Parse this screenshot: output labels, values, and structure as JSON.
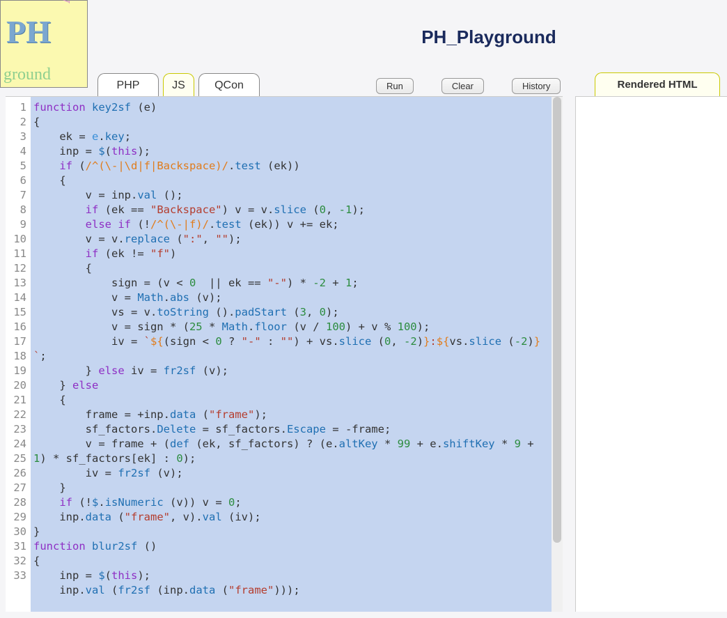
{
  "app_title": "PH_Playground",
  "logo": {
    "ph": "PH",
    "play": "play",
    "ground": "ground"
  },
  "tabs": [
    {
      "label": "PHP",
      "active": false
    },
    {
      "label": "JS",
      "active": true
    },
    {
      "label": "QCon",
      "active": false
    }
  ],
  "actions": {
    "run": "Run",
    "clear": "Clear",
    "history": "History"
  },
  "right_tab": "Rendered HTML",
  "editor": {
    "lines": [
      {
        "n": 1,
        "seg": [
          [
            "kw",
            "function "
          ],
          [
            "fn",
            "key2sf"
          ],
          [
            "op",
            " (e)"
          ]
        ]
      },
      {
        "n": 2,
        "seg": [
          [
            "op",
            "{"
          ]
        ]
      },
      {
        "n": 3,
        "seg": [
          [
            "op",
            "    ek = "
          ],
          [
            "var",
            "e"
          ],
          [
            "op",
            "."
          ],
          [
            "fn",
            "key"
          ],
          [
            "op",
            ";"
          ]
        ]
      },
      {
        "n": 4,
        "seg": [
          [
            "op",
            "    inp = "
          ],
          [
            "fn",
            "$"
          ],
          [
            "op",
            "("
          ],
          [
            "kw",
            "this"
          ],
          [
            "op",
            ");"
          ]
        ]
      },
      {
        "n": 5,
        "seg": [
          [
            "op",
            "    "
          ],
          [
            "kw",
            "if"
          ],
          [
            "op",
            " ("
          ],
          [
            "rgx",
            "/^(\\-|\\d|f|Backspace)/"
          ],
          [
            "op",
            "."
          ],
          [
            "fn",
            "test"
          ],
          [
            "op",
            " (ek))"
          ]
        ]
      },
      {
        "n": 6,
        "seg": [
          [
            "op",
            "    {"
          ]
        ]
      },
      {
        "n": 7,
        "seg": [
          [
            "op",
            "        v = inp."
          ],
          [
            "fn",
            "val"
          ],
          [
            "op",
            " ();"
          ]
        ]
      },
      {
        "n": 8,
        "seg": [
          [
            "op",
            "        "
          ],
          [
            "kw",
            "if"
          ],
          [
            "op",
            " (ek == "
          ],
          [
            "str",
            "\"Backspace\""
          ],
          [
            "op",
            ") v = v."
          ],
          [
            "fn",
            "slice"
          ],
          [
            "op",
            " ("
          ],
          [
            "num",
            "0"
          ],
          [
            "op",
            ", "
          ],
          [
            "num",
            "-1"
          ],
          [
            "op",
            ");"
          ]
        ]
      },
      {
        "n": 9,
        "seg": [
          [
            "op",
            "        "
          ],
          [
            "kw",
            "else if"
          ],
          [
            "op",
            " (!"
          ],
          [
            "rgx",
            "/^(\\-|f)/"
          ],
          [
            "op",
            "."
          ],
          [
            "fn",
            "test"
          ],
          [
            "op",
            " (ek)) v += ek;"
          ]
        ]
      },
      {
        "n": 10,
        "seg": [
          [
            "op",
            "        v = v."
          ],
          [
            "fn",
            "replace"
          ],
          [
            "op",
            " ("
          ],
          [
            "str",
            "\":\""
          ],
          [
            "op",
            ", "
          ],
          [
            "str",
            "\"\""
          ],
          [
            "op",
            ");"
          ]
        ]
      },
      {
        "n": 11,
        "seg": [
          [
            "op",
            "        "
          ],
          [
            "kw",
            "if"
          ],
          [
            "op",
            " (ek != "
          ],
          [
            "str",
            "\"f\""
          ],
          [
            "op",
            ")"
          ]
        ]
      },
      {
        "n": 12,
        "seg": [
          [
            "op",
            "        {"
          ]
        ]
      },
      {
        "n": 13,
        "seg": [
          [
            "op",
            "            sign = (v < "
          ],
          [
            "num",
            "0"
          ],
          [
            "op",
            "  || ek == "
          ],
          [
            "str",
            "\"-\""
          ],
          [
            "op",
            ") * "
          ],
          [
            "num",
            "-2"
          ],
          [
            "op",
            " + "
          ],
          [
            "num",
            "1"
          ],
          [
            "op",
            ";"
          ]
        ]
      },
      {
        "n": 14,
        "seg": [
          [
            "op",
            "            v = "
          ],
          [
            "fn",
            "Math"
          ],
          [
            "op",
            "."
          ],
          [
            "fn",
            "abs"
          ],
          [
            "op",
            " (v);"
          ]
        ]
      },
      {
        "n": 15,
        "seg": [
          [
            "op",
            "            vs = v."
          ],
          [
            "fn",
            "toString"
          ],
          [
            "op",
            " ()."
          ],
          [
            "fn",
            "padStart"
          ],
          [
            "op",
            " ("
          ],
          [
            "num",
            "3"
          ],
          [
            "op",
            ", "
          ],
          [
            "num",
            "0"
          ],
          [
            "op",
            ");"
          ]
        ]
      },
      {
        "n": 16,
        "seg": [
          [
            "op",
            "            v = sign * ("
          ],
          [
            "num",
            "25"
          ],
          [
            "op",
            " * "
          ],
          [
            "fn",
            "Math"
          ],
          [
            "op",
            "."
          ],
          [
            "fn",
            "floor"
          ],
          [
            "op",
            " (v / "
          ],
          [
            "num",
            "100"
          ],
          [
            "op",
            ") + v % "
          ],
          [
            "num",
            "100"
          ],
          [
            "op",
            ");"
          ]
        ]
      },
      {
        "n": 17,
        "seg": [
          [
            "op",
            "            iv = "
          ],
          [
            "str",
            "`"
          ],
          [
            "rgx",
            "${"
          ],
          [
            "op",
            "(sign < "
          ],
          [
            "num",
            "0"
          ],
          [
            "op",
            " ? "
          ],
          [
            "str",
            "\"-\""
          ],
          [
            "op",
            " : "
          ],
          [
            "str",
            "\"\""
          ],
          [
            "op",
            ") + vs."
          ],
          [
            "fn",
            "slice"
          ],
          [
            "op",
            " ("
          ],
          [
            "num",
            "0"
          ],
          [
            "op",
            ", "
          ],
          [
            "num",
            "-2"
          ],
          [
            "op",
            ")"
          ],
          [
            "rgx",
            "}"
          ],
          [
            "str",
            ":"
          ],
          [
            "rgx",
            "${"
          ],
          [
            "op",
            "vs."
          ],
          [
            "fn",
            "slice"
          ],
          [
            "op",
            " ("
          ],
          [
            "num",
            "-2"
          ],
          [
            "op",
            ")"
          ],
          [
            "rgx",
            "}"
          ],
          [
            "str",
            "`"
          ],
          [
            "op",
            ";"
          ]
        ]
      },
      {
        "n": 18,
        "seg": [
          [
            "op",
            "        } "
          ],
          [
            "kw",
            "else"
          ],
          [
            "op",
            " iv = "
          ],
          [
            "fn",
            "fr2sf"
          ],
          [
            "op",
            " (v);"
          ]
        ]
      },
      {
        "n": 19,
        "seg": [
          [
            "op",
            "    } "
          ],
          [
            "kw",
            "else"
          ]
        ]
      },
      {
        "n": 20,
        "seg": [
          [
            "op",
            "    {"
          ]
        ]
      },
      {
        "n": 21,
        "seg": [
          [
            "op",
            "        frame = +inp."
          ],
          [
            "fn",
            "data"
          ],
          [
            "op",
            " ("
          ],
          [
            "str",
            "\"frame\""
          ],
          [
            "op",
            ");"
          ]
        ]
      },
      {
        "n": 22,
        "seg": [
          [
            "op",
            "        sf_factors."
          ],
          [
            "fn",
            "Delete"
          ],
          [
            "op",
            " = sf_factors."
          ],
          [
            "fn",
            "Escape"
          ],
          [
            "op",
            " = -frame;"
          ]
        ]
      },
      {
        "n": 23,
        "seg": [
          [
            "op",
            "        v = frame + ("
          ],
          [
            "fn",
            "def"
          ],
          [
            "op",
            " (ek, sf_factors) ? (e."
          ],
          [
            "fn",
            "altKey"
          ],
          [
            "op",
            " * "
          ],
          [
            "num",
            "99"
          ],
          [
            "op",
            " + e."
          ],
          [
            "fn",
            "shiftKey"
          ],
          [
            "op",
            " * "
          ],
          [
            "num",
            "9"
          ],
          [
            "op",
            " + "
          ],
          [
            "num",
            "1"
          ],
          [
            "op",
            ") * sf_factors[ek] : "
          ],
          [
            "num",
            "0"
          ],
          [
            "op",
            ");"
          ]
        ]
      },
      {
        "n": 24,
        "seg": [
          [
            "op",
            "        iv = "
          ],
          [
            "fn",
            "fr2sf"
          ],
          [
            "op",
            " (v);"
          ]
        ]
      },
      {
        "n": 25,
        "seg": [
          [
            "op",
            "    }"
          ]
        ]
      },
      {
        "n": 26,
        "seg": [
          [
            "op",
            "    "
          ],
          [
            "kw",
            "if"
          ],
          [
            "op",
            " (!"
          ],
          [
            "fn",
            "$"
          ],
          [
            "op",
            "."
          ],
          [
            "fn",
            "isNumeric"
          ],
          [
            "op",
            " (v)) v = "
          ],
          [
            "num",
            "0"
          ],
          [
            "op",
            ";"
          ]
        ]
      },
      {
        "n": 27,
        "seg": [
          [
            "op",
            "    inp."
          ],
          [
            "fn",
            "data"
          ],
          [
            "op",
            " ("
          ],
          [
            "str",
            "\"frame\""
          ],
          [
            "op",
            ", v)."
          ],
          [
            "fn",
            "val"
          ],
          [
            "op",
            " (iv);"
          ]
        ]
      },
      {
        "n": 28,
        "seg": [
          [
            "op",
            "}"
          ]
        ]
      },
      {
        "n": 29,
        "seg": [
          [
            "op",
            ""
          ]
        ]
      },
      {
        "n": 30,
        "seg": [
          [
            "kw",
            "function "
          ],
          [
            "fn",
            "blur2sf"
          ],
          [
            "op",
            " ()"
          ]
        ]
      },
      {
        "n": 31,
        "seg": [
          [
            "op",
            "{"
          ]
        ]
      },
      {
        "n": 32,
        "seg": [
          [
            "op",
            "    inp = "
          ],
          [
            "fn",
            "$"
          ],
          [
            "op",
            "("
          ],
          [
            "kw",
            "this"
          ],
          [
            "op",
            ");"
          ]
        ]
      },
      {
        "n": 33,
        "seg": [
          [
            "op",
            "    inp."
          ],
          [
            "fn",
            "val"
          ],
          [
            "op",
            " ("
          ],
          [
            "fn",
            "fr2sf"
          ],
          [
            "op",
            " (inp."
          ],
          [
            "fn",
            "data"
          ],
          [
            "op",
            " ("
          ],
          [
            "str",
            "\"frame\""
          ],
          [
            "op",
            ")));"
          ]
        ]
      }
    ]
  }
}
